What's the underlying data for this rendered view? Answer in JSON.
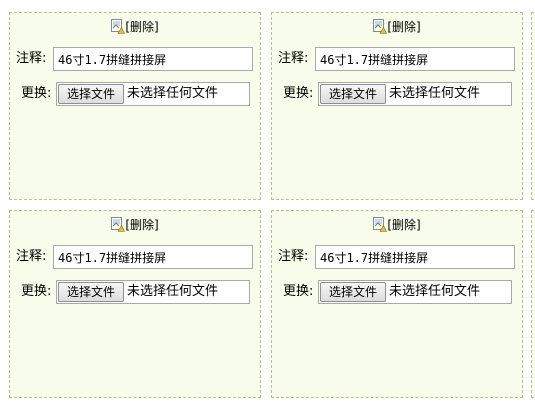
{
  "items": [
    {
      "image_alt": "[删除]",
      "note_label": "注释:",
      "note_value": "46寸1.7拼缝拼接屏",
      "replace_label": "更换:",
      "file_button": "选择文件",
      "file_status": "未选择任何文件"
    },
    {
      "image_alt": "[删除]",
      "note_label": "注释:",
      "note_value": "46寸1.7拼缝拼接屏",
      "replace_label": "更换:",
      "file_button": "选择文件",
      "file_status": "未选择任何文件"
    },
    {
      "image_alt": "[删除]",
      "note_label": "注释:",
      "note_value": "46寸1.7拼缝拼接屏",
      "replace_label": "更换:",
      "file_button": "选择文件",
      "file_status": "未选择任何文件"
    },
    {
      "image_alt": "[删除]",
      "note_label": "注释:",
      "note_value": "46寸1.7拼缝拼接屏",
      "replace_label": "更换:",
      "file_button": "选择文件",
      "file_status": "未选择任何文件"
    }
  ],
  "colors": {
    "card_background": "#f8fdeb",
    "card_border": "#aacc88"
  },
  "icons": {
    "image_placeholder": "broken-image-icon"
  }
}
